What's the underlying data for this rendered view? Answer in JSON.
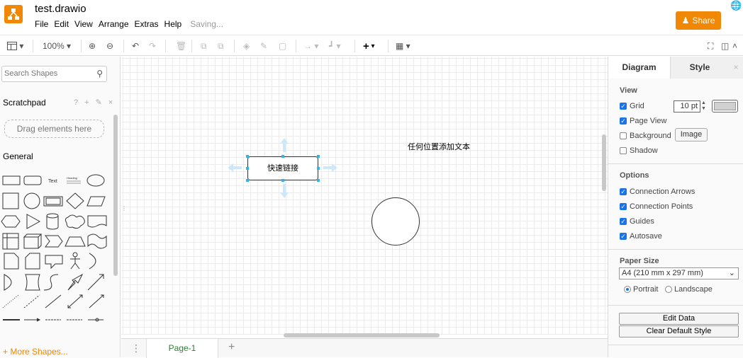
{
  "app": {
    "title": "test.drawio",
    "menus": [
      "File",
      "Edit",
      "View",
      "Arrange",
      "Extras",
      "Help"
    ],
    "status": "Saving...",
    "share_label": "Share",
    "brand_color": "#f08705"
  },
  "toolbar": {
    "zoom": "100%"
  },
  "sidebar": {
    "search_placeholder": "Search Shapes",
    "scratchpad_label": "Scratchpad",
    "scratchpad_icons": "? + ✎ ×",
    "drag_label": "Drag elements here",
    "general_label": "General",
    "text_shape_label": "Text",
    "heading_shape_label": "Heading",
    "more_shapes_label": "+ More Shapes..."
  },
  "canvas": {
    "node_label": "快速链接",
    "free_text": "任何位置添加文本"
  },
  "pages": {
    "current": "Page-1"
  },
  "format_panel": {
    "tabs": [
      "Diagram",
      "Style"
    ],
    "view_title": "View",
    "grid_label": "Grid",
    "grid_size": "10 pt",
    "page_view_label": "Page View",
    "background_label": "Background",
    "image_button": "Image",
    "shadow_label": "Shadow",
    "options_title": "Options",
    "connection_arrows": "Connection Arrows",
    "connection_points": "Connection Points",
    "guides": "Guides",
    "autosave": "Autosave",
    "paper_size_title": "Paper Size",
    "paper_size_value": "A4 (210 mm x 297 mm)",
    "portrait": "Portrait",
    "landscape": "Landscape",
    "edit_data": "Edit Data",
    "clear_default_style": "Clear Default Style"
  }
}
